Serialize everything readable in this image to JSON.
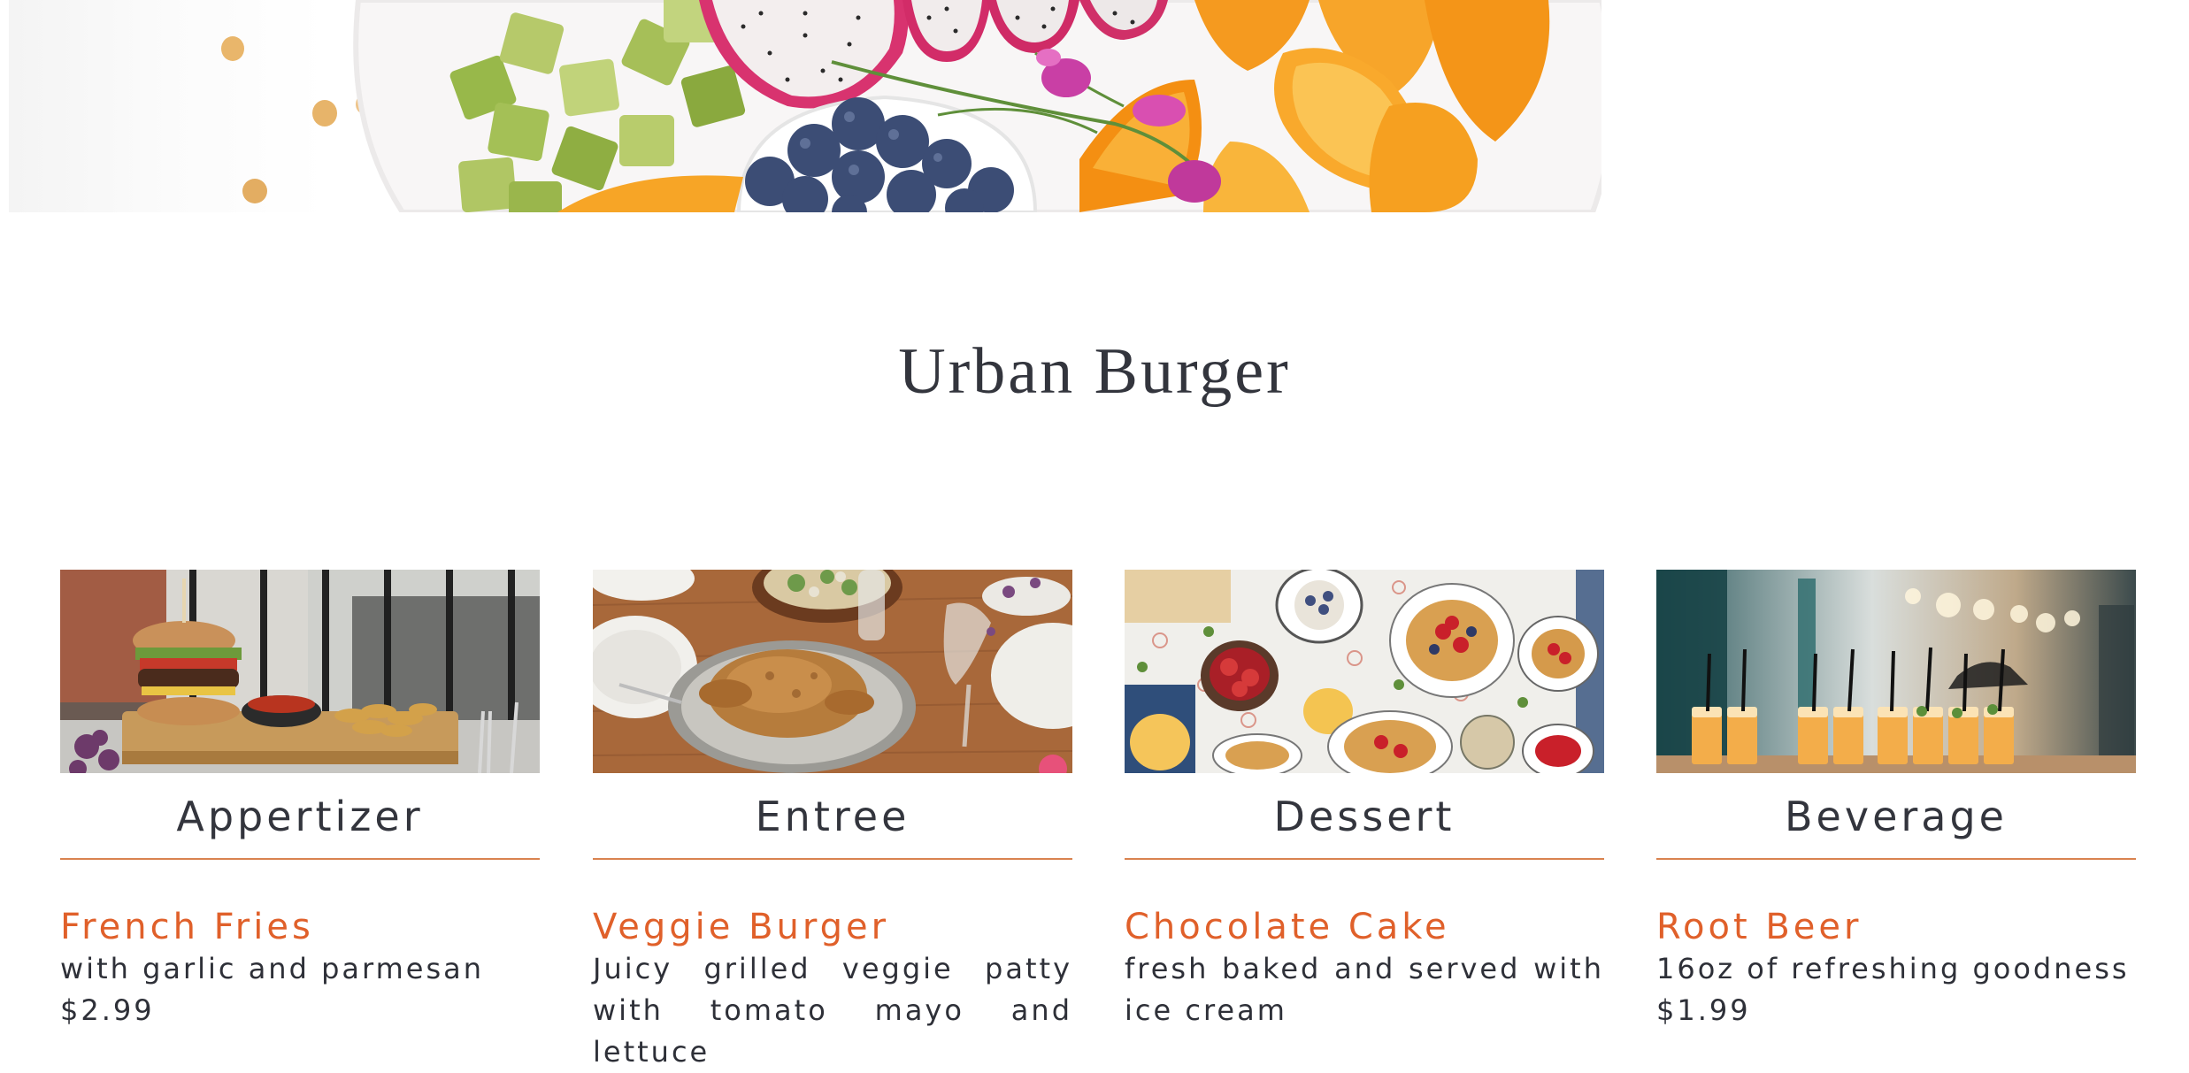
{
  "restaurant": {
    "name": "Urban Burger"
  },
  "categories": [
    {
      "label": "Appertizer",
      "photo_icon": "burger-photo",
      "item": {
        "name": "French Fries",
        "description": "with garlic and parmesan",
        "price": "$2.99"
      }
    },
    {
      "label": "Entree",
      "photo_icon": "roast-chicken-photo",
      "item": {
        "name": "Veggie Burger",
        "description": "Juicy grilled veggie patty with tomato mayo and lettuce",
        "price": ""
      }
    },
    {
      "label": "Dessert",
      "photo_icon": "waffles-photo",
      "item": {
        "name": "Chocolate Cake",
        "description": "fresh baked and served with ice cream",
        "price": ""
      }
    },
    {
      "label": "Beverage",
      "photo_icon": "drinks-photo",
      "item": {
        "name": "Root Beer",
        "description": "16oz of refreshing goodness",
        "price": "$1.99"
      }
    }
  ],
  "colors": {
    "accent": "#e0602a",
    "rule": "#d9834f",
    "text": "#33353d"
  }
}
